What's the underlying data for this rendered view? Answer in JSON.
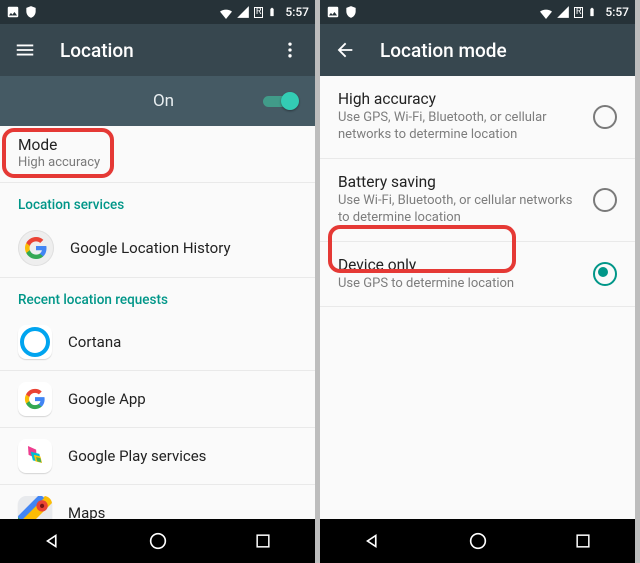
{
  "status": {
    "time": "5:57",
    "battery_label": "R"
  },
  "left": {
    "appbar_title": "Location",
    "toggle_label": "On",
    "toggle_on": true,
    "mode": {
      "label": "Mode",
      "value": "High accuracy"
    },
    "section_services": "Location services",
    "services": [
      {
        "name": "Google Location History",
        "icon": "google-g-icon"
      }
    ],
    "section_recent": "Recent location requests",
    "recent": [
      {
        "name": "Cortana",
        "icon": "cortana-icon"
      },
      {
        "name": "Google App",
        "icon": "google-app-icon"
      },
      {
        "name": "Google Play services",
        "icon": "play-services-icon"
      },
      {
        "name": "Maps",
        "icon": "maps-icon"
      }
    ]
  },
  "right": {
    "appbar_title": "Location mode",
    "options": [
      {
        "title": "High accuracy",
        "subtitle": "Use GPS, Wi-Fi, Bluetooth, or cellular networks to determine location",
        "selected": false
      },
      {
        "title": "Battery saving",
        "subtitle": "Use Wi-Fi, Bluetooth, or cellular networks to determine location",
        "selected": false
      },
      {
        "title": "Device only",
        "subtitle": "Use GPS to determine location",
        "selected": true
      }
    ]
  },
  "colors": {
    "accent": "#009688",
    "highlight": "#e53935"
  }
}
